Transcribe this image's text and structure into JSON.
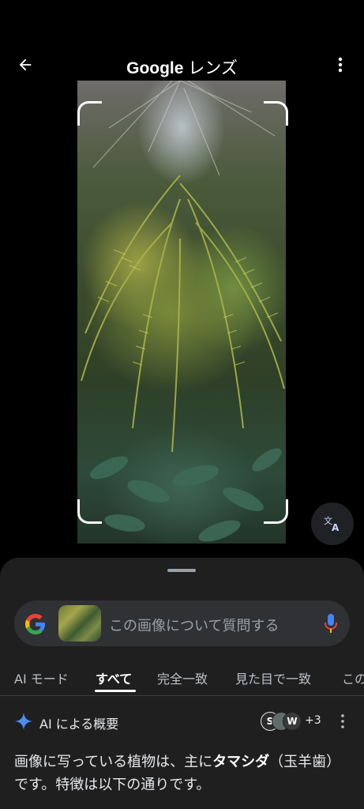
{
  "header": {
    "title_brand": "Google",
    "title_suffix": " レンズ",
    "back_icon": "arrow-back-icon",
    "menu_icon": "more-vert-icon"
  },
  "search": {
    "placeholder": "この画像について質問する",
    "logo_icon": "google-g-icon",
    "mic_icon": "mic-icon"
  },
  "tabs": [
    {
      "label": "AI モード",
      "active": false
    },
    {
      "label": "すべて",
      "active": true
    },
    {
      "label": "完全一致",
      "active": false
    },
    {
      "label": "見た目で一致",
      "active": false
    },
    {
      "label": "この",
      "active": false
    }
  ],
  "ai_overview": {
    "title": "AI による概要",
    "sources": [
      {
        "initial": "S",
        "color": "#e8eaed"
      },
      {
        "initial": "",
        "color": "#5f6e6a"
      },
      {
        "initial": "W",
        "color": "#e8eaed"
      }
    ],
    "sources_more": "+3",
    "body_pre": "画像に写っている植物は、主に",
    "body_bold": "タマシダ",
    "body_post": "（玉羊歯）です。特徴は以下の通りです。"
  },
  "colors": {
    "accent_sparkle": "#4c8df6",
    "google_blue": "#4285f4",
    "google_red": "#ea4335",
    "google_yellow": "#fbbc05",
    "google_green": "#34a853"
  }
}
